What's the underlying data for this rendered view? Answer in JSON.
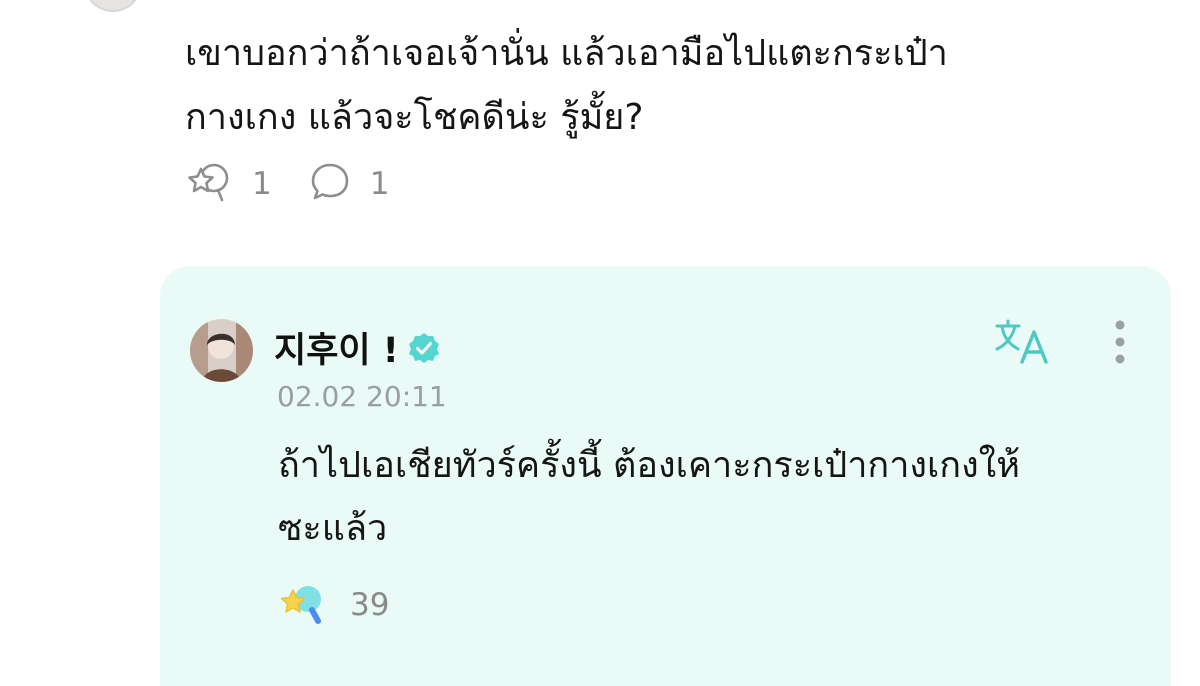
{
  "post": {
    "text_lines": [
      "เขาบอกว่าถ้าเจอเจ้านั่น แล้วเอามือไปแตะกระเป๋า",
      "กางเกง แล้วจะโชคดีน่ะ รู้มั้ย?"
    ],
    "actions": {
      "cheer": {
        "icon": "cheer-star-icon",
        "count": "1"
      },
      "comment": {
        "icon": "comment-bubble-icon",
        "count": "1"
      }
    }
  },
  "reply": {
    "author_name": "지후이 !",
    "verified_icon": "verified-badge-icon",
    "timestamp": "02.02 20:11",
    "text_lines": [
      "ถ้าไปเอเชียทัวร์ครั้งนี้ ต้องเคาะกระเป๋ากางเกงให้",
      "ซะแล้ว"
    ],
    "likes": {
      "icon": "cheer-star-colored-icon",
      "count": "39"
    },
    "translate_icon": "translate-icon",
    "more_icon": "more-vertical-icon"
  },
  "colors": {
    "accent": "#4cc9c0",
    "reply_background": "#eafaf7",
    "muted_text": "#8a8a8a",
    "timestamp_text": "#9a9ea0"
  }
}
